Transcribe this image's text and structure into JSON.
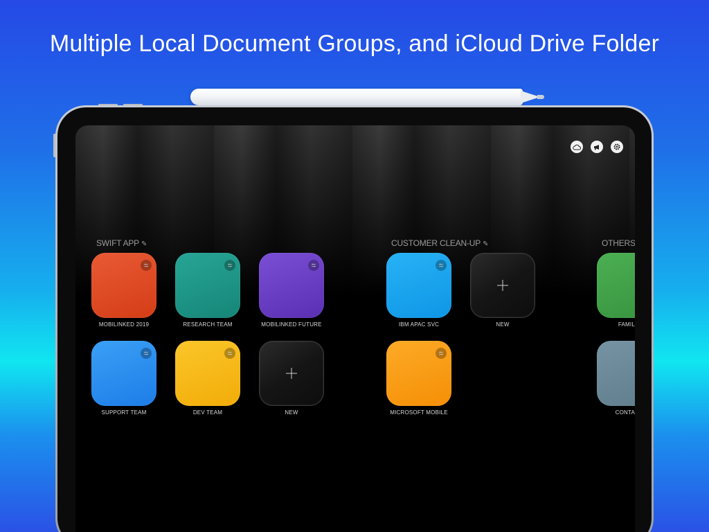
{
  "headline": "Multiple Local Document Groups, and iCloud Drive Folder",
  "toolbar": {
    "icons": [
      "cloud-icon",
      "megaphone-icon",
      "gear-icon"
    ]
  },
  "groups": [
    {
      "title": "SWIFT APP",
      "tiles": [
        {
          "label": "MOBILINKED 2019",
          "color": "#e0461f"
        },
        {
          "label": "RESEARCH TEAM",
          "color": "#1f9a8a"
        },
        {
          "label": "MOBILINKED FUTURE",
          "color": "#6b3fc4"
        },
        {
          "label": "SUPPORT TEAM",
          "color": "#2a8ff0"
        },
        {
          "label": "DEV TEAM",
          "color": "#f5b80f"
        },
        {
          "label": "NEW",
          "type": "new"
        }
      ]
    },
    {
      "title": "CUSTOMER CLEAN-UP",
      "tiles": [
        {
          "label": "IBM APAC SVC",
          "color": "#17a6ee"
        },
        {
          "label": "NEW",
          "type": "new"
        },
        {
          "label": "MICROSOFT MOBILE",
          "color": "#fb9a10"
        }
      ]
    },
    {
      "title": "OTHERS",
      "tiles": [
        {
          "label": "FAMIL",
          "color": "#3fa04a"
        },
        {
          "label": "CONTA",
          "color": "#6b8a9a"
        }
      ]
    }
  ]
}
